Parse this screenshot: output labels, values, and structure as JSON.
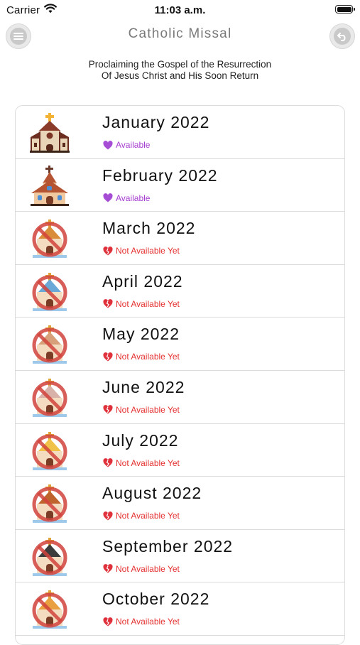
{
  "status_bar": {
    "carrier": "Carrier",
    "time": "11:03 a.m."
  },
  "nav": {
    "title": "Catholic Missal",
    "left_icon": "menu-icon",
    "right_icon": "back-arrow-icon"
  },
  "subtitle": {
    "line1": "Proclaiming the Gospel of the Resurrection",
    "line2": "Of Jesus Christ and His Soon Return"
  },
  "colors": {
    "available": "#a43ccf",
    "not_available": "#e53030",
    "separator": "#dcdcdc"
  },
  "months": [
    {
      "label": "January 2022",
      "status": "Available",
      "available": true,
      "icon": "church-icon"
    },
    {
      "label": "February 2022",
      "status": "Available",
      "available": true,
      "icon": "chapel-icon"
    },
    {
      "label": "March 2022",
      "status": "Not Available Yet",
      "available": false,
      "icon": "church-crossed-out-icon"
    },
    {
      "label": "April 2022",
      "status": "Not Available Yet",
      "available": false,
      "icon": "church-crossed-out-icon"
    },
    {
      "label": "May 2022",
      "status": "Not Available Yet",
      "available": false,
      "icon": "church-crossed-out-icon"
    },
    {
      "label": "June 2022",
      "status": "Not Available Yet",
      "available": false,
      "icon": "church-crossed-out-icon"
    },
    {
      "label": "July 2022",
      "status": "Not Available Yet",
      "available": false,
      "icon": "church-crossed-out-icon"
    },
    {
      "label": "August 2022",
      "status": "Not Available Yet",
      "available": false,
      "icon": "church-crossed-out-icon"
    },
    {
      "label": "September 2022",
      "status": "Not Available Yet",
      "available": false,
      "icon": "church-crossed-out-icon"
    },
    {
      "label": "October 2022",
      "status": "Not Available Yet",
      "available": false,
      "icon": "church-crossed-out-icon"
    }
  ]
}
